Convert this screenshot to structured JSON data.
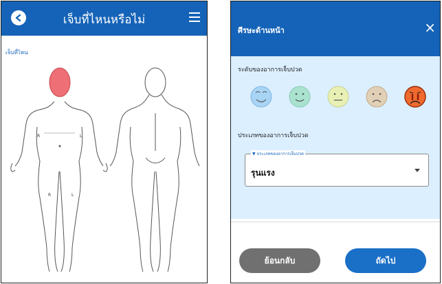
{
  "left_screen": {
    "title": "เจ็บที่ไหนหรือไม่",
    "where_label": "เจ็บที่ไหน",
    "marks": {
      "right": "R",
      "left": "L"
    }
  },
  "dialog": {
    "title": "ศีรษะด้านหน้า",
    "close_symbol": "×",
    "level_label": "ระดับของอาการเจ็บปวด",
    "faces": [
      {
        "icon": "very-happy-face-icon",
        "color": "#a8d4f5"
      },
      {
        "icon": "happy-face-icon",
        "color": "#a9e3cf"
      },
      {
        "icon": "neutral-face-icon",
        "color": "#e9f0b4"
      },
      {
        "icon": "sad-face-icon",
        "color": "#e2d0b6"
      },
      {
        "icon": "crying-face-icon",
        "color": "#f06a2e",
        "selected": true
      }
    ],
    "type_label": "ประเภทของอาการเจ็บปวด",
    "select": {
      "floating_label": "ประเภทของอาการเจ็บปวด",
      "value": "รุนแรง"
    },
    "back_button": "ย้อนกลับ",
    "next_button": "ถัดไป"
  },
  "colors": {
    "primary": "#1563b8",
    "dialog_bg": "#dcefff",
    "highlight": "#ee6f75"
  }
}
